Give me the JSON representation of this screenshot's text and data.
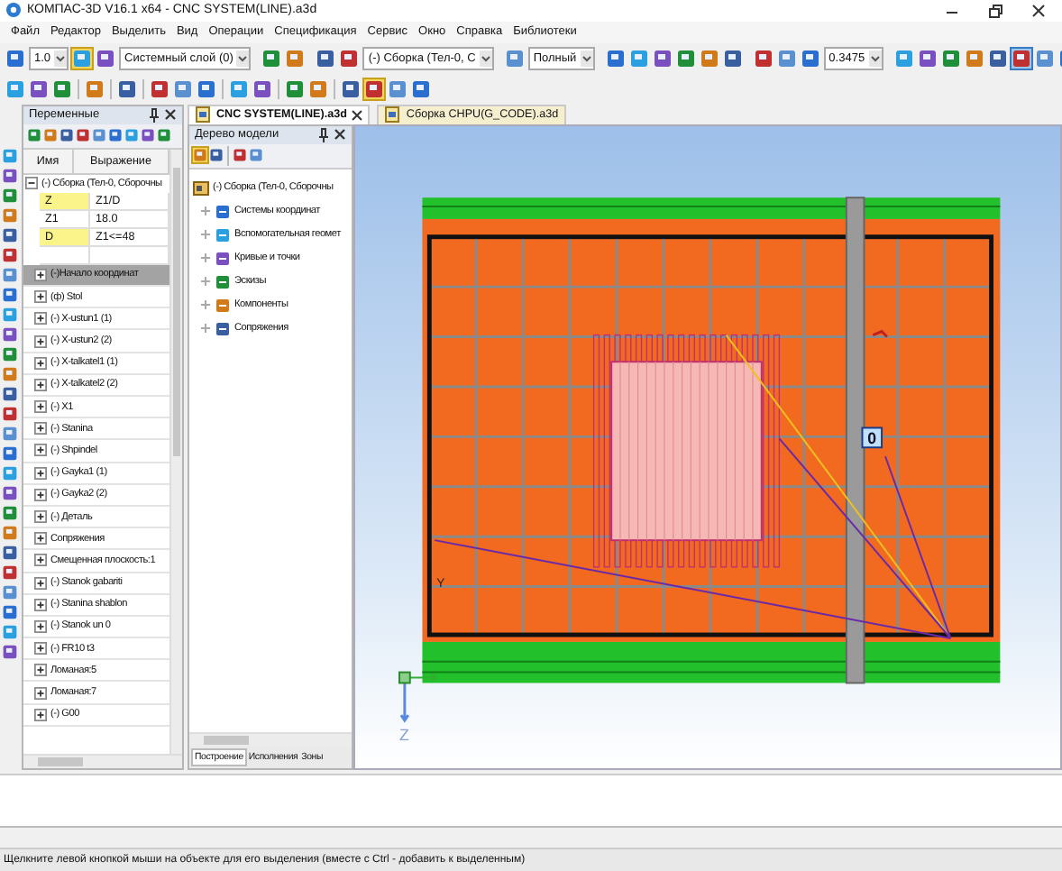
{
  "window": {
    "title": "КОМПАС-3D V16.1 x64 - CNC SYSTEM(LINE).a3d"
  },
  "menu": [
    "Файл",
    "Редактор",
    "Выделить",
    "Вид",
    "Операции",
    "Спецификация",
    "Сервис",
    "Окно",
    "Справка",
    "Библиотеки"
  ],
  "toolbar": {
    "combos": [
      {
        "value": "1.0"
      },
      {
        "value": "Системный слой (0)"
      },
      {
        "value": "(-) Сборка (Тел-0, С"
      },
      {
        "value": "Полный"
      },
      {
        "value": "0.3475"
      }
    ]
  },
  "variables_panel": {
    "title": "Переменные",
    "columns": [
      "Имя",
      "Выражение"
    ],
    "group": {
      "label": "(-) Сборка (Тел-0, Сборочны",
      "expanded": true
    },
    "variables": [
      {
        "name": "Z",
        "expression": "Z1/D",
        "highlighted": true
      },
      {
        "name": "Z1",
        "expression": "18.0",
        "highlighted": false
      },
      {
        "name": "D",
        "expression": "Z1<=48",
        "highlighted": true
      }
    ],
    "items": [
      {
        "label": "(-)Начало координат",
        "selected": true
      },
      {
        "label": "(ф) Stol",
        "selected": false
      },
      {
        "label": "(-) X-ustun1 (1)",
        "selected": false
      },
      {
        "label": "(-) X-ustun2 (2)",
        "selected": false
      },
      {
        "label": "(-) X-talkatel1 (1)",
        "selected": false
      },
      {
        "label": "(-) X-talkatel2 (2)",
        "selected": false
      },
      {
        "label": "(-) X1",
        "selected": false
      },
      {
        "label": "(-) Stanina",
        "selected": false
      },
      {
        "label": "(-) Shpindel",
        "selected": false
      },
      {
        "label": "(-) Gayka1 (1)",
        "selected": false
      },
      {
        "label": "(-) Gayka2 (2)",
        "selected": false
      },
      {
        "label": "(-) Деталь",
        "selected": false
      },
      {
        "label": "Сопряжения",
        "selected": false
      },
      {
        "label": "Смещенная плоскость:1",
        "selected": false
      },
      {
        "label": "(-) Stanok gabariti",
        "selected": false
      },
      {
        "label": "(-) Stanina shablon",
        "selected": false
      },
      {
        "label": "(-) Stanok un 0",
        "selected": false
      },
      {
        "label": "(-) FR10 t3",
        "selected": false
      },
      {
        "label": "Ломаная:5",
        "selected": false
      },
      {
        "label": "Ломаная:7",
        "selected": false
      },
      {
        "label": "(-) G00",
        "selected": false
      }
    ]
  },
  "document_tabs": [
    {
      "label": "CNC SYSTEM(LINE).a3d",
      "selected": true
    },
    {
      "label": "Сборка CHPU(G_CODE).a3d",
      "selected": false
    }
  ],
  "model_tree": {
    "title": "Дерево модели",
    "root": {
      "label": "(-) Сборка (Тел-0, Сборочны",
      "children": [
        {
          "label": "Системы координат",
          "expanded": false
        },
        {
          "label": "Вспомогательная геомет",
          "expanded": false
        },
        {
          "label": "Кривые и точки",
          "expanded": false
        },
        {
          "label": "Эскизы",
          "expanded": false
        },
        {
          "label": "Компоненты",
          "expanded": false
        },
        {
          "label": "Сопряжения",
          "expanded": false
        }
      ]
    },
    "tabs": [
      {
        "label": "Построение",
        "selected": true
      },
      {
        "label": "Исполнения",
        "selected": false
      },
      {
        "label": "Зоны",
        "selected": false
      }
    ]
  },
  "viewport": {
    "point_label": "0",
    "local_axis_label": "Y",
    "axis_label": "Z"
  },
  "status_bar": "Щелкните левой кнопкой мыши на объекте для его выделения (вместе с Ctrl - добавить к выделенным)"
}
